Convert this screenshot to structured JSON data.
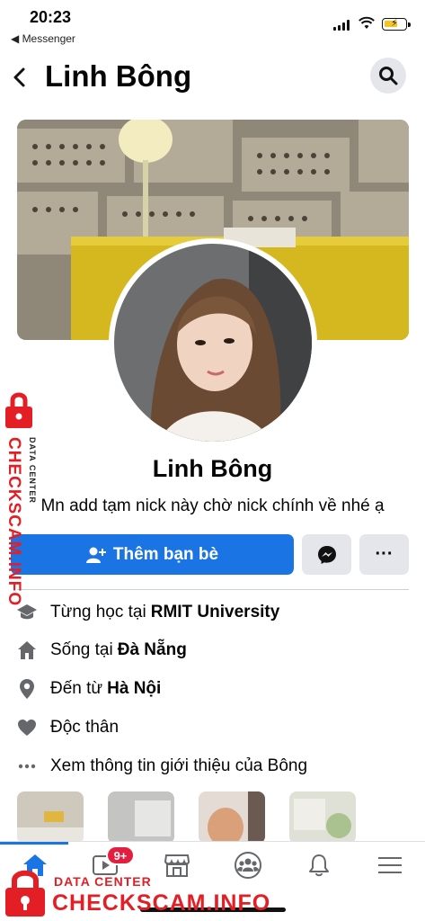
{
  "status_bar": {
    "time": "20:23",
    "back_app": "◀ Messenger"
  },
  "header": {
    "title": "Linh Bông",
    "back_icon": "chevron-left-icon",
    "search_icon": "search-icon"
  },
  "profile": {
    "name": "Linh Bông",
    "bio": "Mn add tạm nick này chờ nick chính về nhé ạ"
  },
  "actions": {
    "add_friend_label": "Thêm bạn bè",
    "message_icon": "messenger-icon",
    "more_label": "···"
  },
  "intro": {
    "items": [
      {
        "icon": "graduation-cap-icon",
        "prefix": "Từng học tại",
        "bold": "RMIT University"
      },
      {
        "icon": "home-icon",
        "prefix": "Sống tại",
        "bold": "Đà Nẵng"
      },
      {
        "icon": "location-pin-icon",
        "prefix": "Đến từ",
        "bold": "Hà Nội"
      },
      {
        "icon": "heart-icon",
        "prefix": "Độc thân",
        "bold": ""
      },
      {
        "icon": "more-dots-icon",
        "prefix": "Xem thông tin giới thiệu của Bông",
        "bold": ""
      }
    ]
  },
  "bottom_nav": {
    "items": [
      "home-icon",
      "watch-icon",
      "marketplace-icon",
      "groups-icon",
      "bell-icon",
      "menu-icon"
    ],
    "badge": "9+"
  },
  "watermark": {
    "side_text": "CHECKSCAM.INFO",
    "side_sub": "DATA CENTER",
    "bottom_sub": "DATA CENTER",
    "bottom_text": "CHECKSCAM.INFO"
  },
  "colors": {
    "primary": "#1b74e4",
    "badge": "#e41e3f",
    "watermark": "#e31e24",
    "secondary_bg": "#e4e6eb"
  }
}
